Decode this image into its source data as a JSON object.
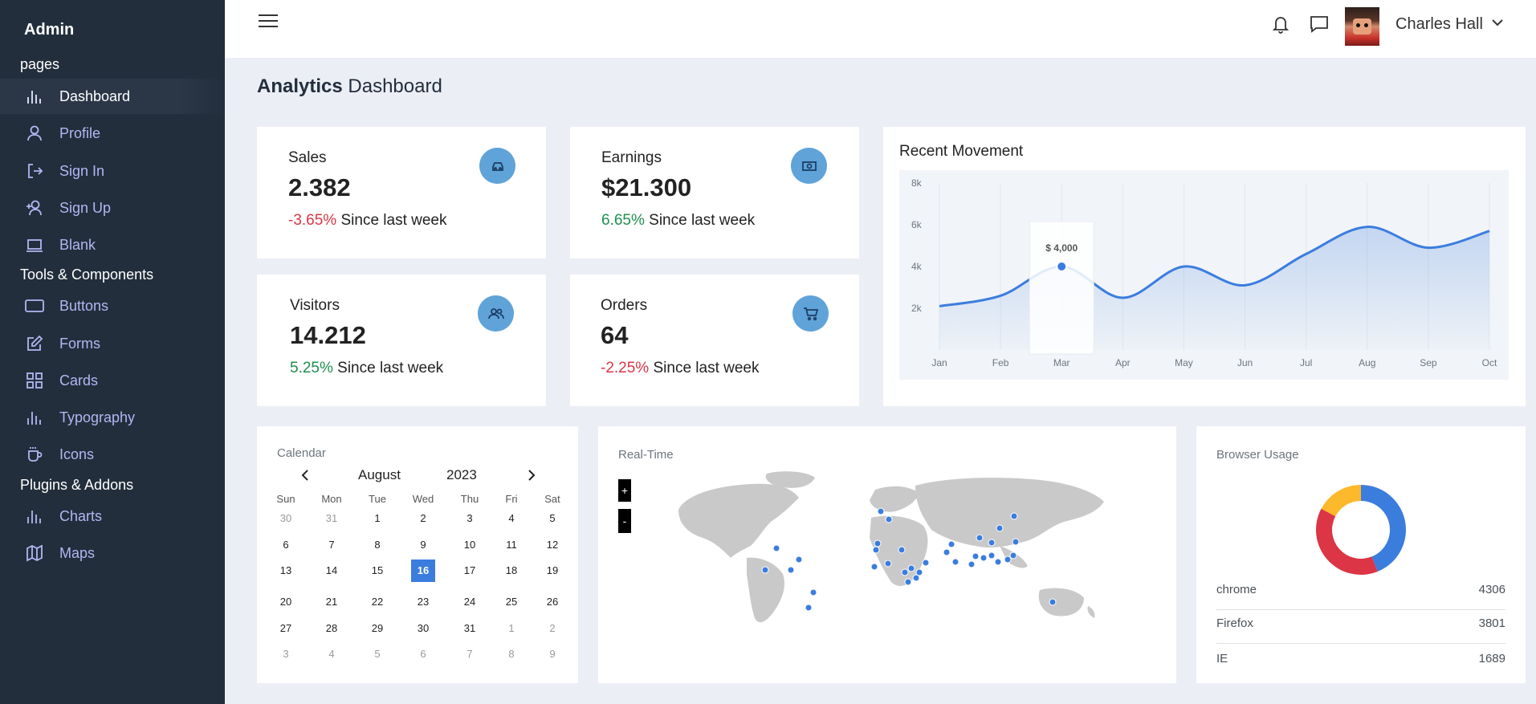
{
  "brand": "Admin",
  "sections": {
    "pages": "pages",
    "tools": "Tools & Components",
    "plugins": "Plugins & Addons"
  },
  "nav": {
    "dashboard": "Dashboard",
    "profile": "Profile",
    "signin": "Sign In",
    "signup": "Sign Up",
    "blank": "Blank",
    "buttons": "Buttons",
    "forms": "Forms",
    "cards": "Cards",
    "typography": "Typography",
    "icons": "Icons",
    "charts": "Charts",
    "maps": "Maps"
  },
  "topbar": {
    "username": "Charles Hall"
  },
  "page": {
    "title_bold": "Analytics",
    "title_rest": " Dashboard"
  },
  "stats": {
    "sales": {
      "label": "Sales",
      "value": "2.382",
      "change": "-3.65%",
      "since": " Since last week",
      "icon": "car-icon"
    },
    "earnings": {
      "label": "Earnings",
      "value": "$21.300",
      "change": "6.65%",
      "since": " Since last week",
      "icon": "money-icon"
    },
    "visitors": {
      "label": "Visitors",
      "value": "14.212",
      "change": "5.25%",
      "since": " Since last week",
      "icon": "users-icon"
    },
    "orders": {
      "label": "Orders",
      "value": "64",
      "change": "-2.25%",
      "since": " Since last week",
      "icon": "cart-icon"
    }
  },
  "movement": {
    "title": "Recent Movement",
    "tooltip": "$ 4,000"
  },
  "calendar": {
    "title": "Calendar",
    "month": "August",
    "year": "2023",
    "dow": [
      "Sun",
      "Mon",
      "Tue",
      "Wed",
      "Thu",
      "Fri",
      "Sat"
    ],
    "weeks": [
      [
        "30",
        "31",
        "1",
        "2",
        "3",
        "4",
        "5"
      ],
      [
        "6",
        "7",
        "8",
        "9",
        "10",
        "11",
        "12"
      ],
      [
        "13",
        "14",
        "15",
        "16",
        "17",
        "18",
        "19"
      ],
      [
        "20",
        "21",
        "22",
        "23",
        "24",
        "25",
        "26"
      ],
      [
        "27",
        "28",
        "29",
        "30",
        "31",
        "1",
        "2"
      ],
      [
        "3",
        "4",
        "5",
        "6",
        "7",
        "8",
        "9"
      ]
    ],
    "selected": "16"
  },
  "realtime": {
    "title": "Real-Time",
    "zoom_in": "+",
    "zoom_out": "-"
  },
  "browser": {
    "title": "Browser Usage",
    "rows": [
      {
        "name": "chrome",
        "value": "4306",
        "color": "#3b7ddd"
      },
      {
        "name": "Firefox",
        "value": "3801",
        "color": "#dc3545"
      },
      {
        "name": "IE",
        "value": "1689",
        "color": "#fcb92c"
      }
    ]
  },
  "chart_data": [
    {
      "type": "area",
      "title": "Recent Movement",
      "categories": [
        "Jan",
        "Feb",
        "Mar",
        "Apr",
        "May",
        "Jun",
        "Jul",
        "Aug",
        "Sep",
        "Oct"
      ],
      "y_ticks": [
        "2k",
        "4k",
        "6k",
        "8k"
      ],
      "ylim": [
        0,
        8000
      ],
      "series": [
        {
          "values": [
            2100,
            2600,
            4000,
            2500,
            4000,
            3100,
            4600,
            5900,
            4900,
            5700
          ],
          "color": "#3b7ddd"
        }
      ],
      "grid": true,
      "legend": "none"
    },
    {
      "type": "pie",
      "title": "Browser Usage",
      "labels": [
        "chrome",
        "Firefox",
        "IE"
      ],
      "values": [
        4306,
        3801,
        1689
      ],
      "colors": [
        "#3b7ddd",
        "#dc3545",
        "#fcb92c"
      ],
      "legend": "none"
    }
  ]
}
